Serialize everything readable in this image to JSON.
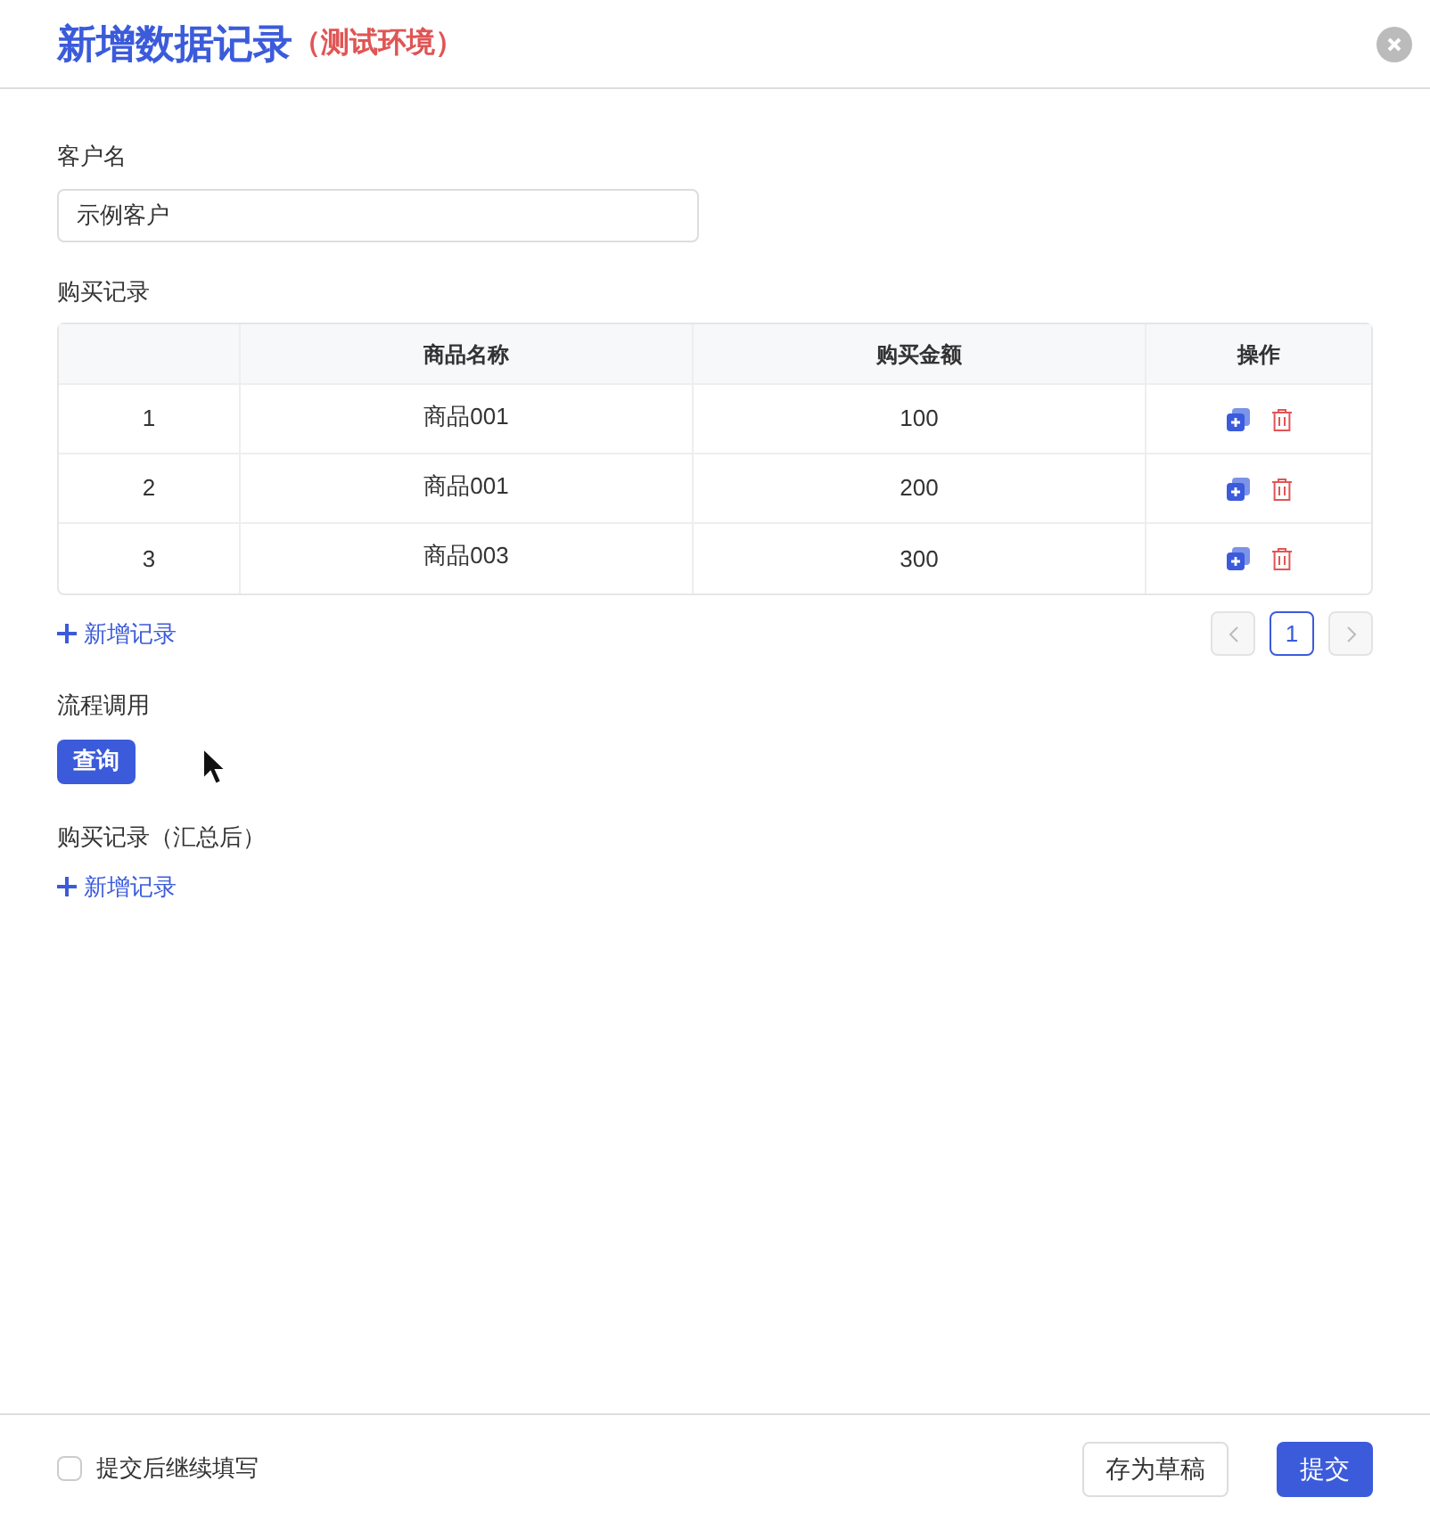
{
  "dialog": {
    "title": "新增数据记录",
    "env_tag": "（测试环境）"
  },
  "customer": {
    "label": "客户名",
    "value": "示例客户"
  },
  "purchases": {
    "label": "购买记录",
    "columns": [
      "商品名称",
      "购买金额",
      "操作"
    ],
    "rows": [
      {
        "index": "1",
        "product": "商品001",
        "amount": "100"
      },
      {
        "index": "2",
        "product": "商品001",
        "amount": "200"
      },
      {
        "index": "3",
        "product": "商品003",
        "amount": "300"
      }
    ],
    "add_label": "新增记录",
    "pagination": {
      "pages": [
        {
          "label": "1",
          "selected": true
        }
      ]
    }
  },
  "process": {
    "label": "流程调用",
    "button": "查询"
  },
  "summary": {
    "label": "购买记录（汇总后）",
    "add_label": "新增记录"
  },
  "footer": {
    "continue_checkbox": {
      "label": "提交后继续填写",
      "checked": false
    },
    "draft_button": "存为草稿",
    "submit_button": "提交"
  }
}
